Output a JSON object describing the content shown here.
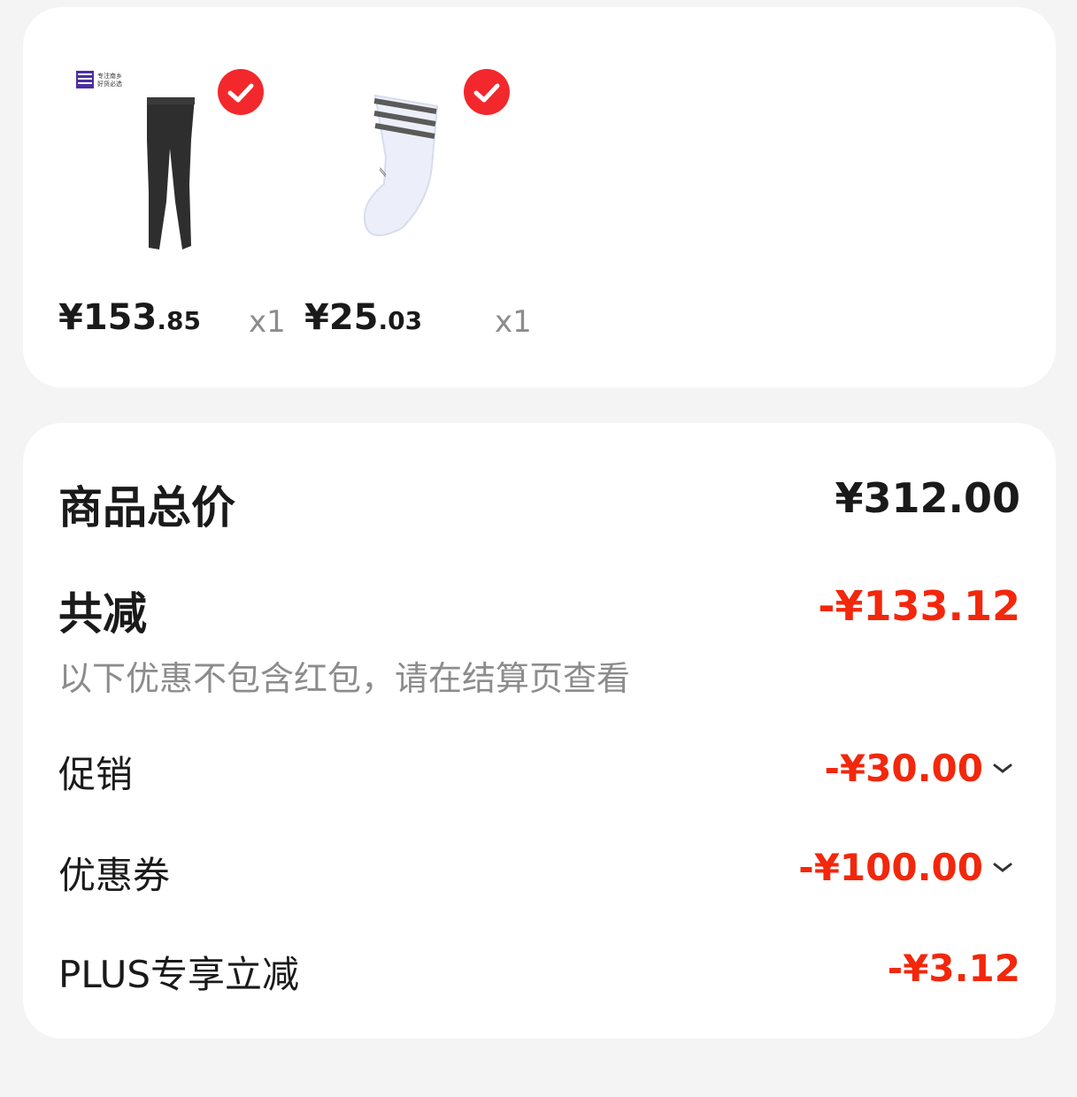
{
  "products": [
    {
      "image": "black-pants",
      "brand_badge": "专注南乡 好货必选",
      "selected": true,
      "price_main": "¥153",
      "price_decimal": ".85",
      "quantity": "x1"
    },
    {
      "image": "white-sock",
      "selected": true,
      "price_main": "¥25",
      "price_decimal": ".03",
      "quantity": "x1"
    }
  ],
  "summary": {
    "total_label": "商品总价",
    "total_value": "¥312.00",
    "discount_label": "共减",
    "discount_value": "-¥133.12",
    "discount_note": "以下优惠不包含红包，请在结算页查看",
    "items": [
      {
        "label": "促销",
        "value": "-¥30.00",
        "expandable": true
      },
      {
        "label": "优惠券",
        "value": "-¥100.00",
        "expandable": true
      },
      {
        "label": "PLUS专享立减",
        "value": "-¥3.12",
        "expandable": false
      }
    ]
  },
  "colors": {
    "accent_red": "#f2270c",
    "check_red": "#f2282c",
    "muted_text": "#8c8c8c",
    "background": "#f4f4f4"
  }
}
